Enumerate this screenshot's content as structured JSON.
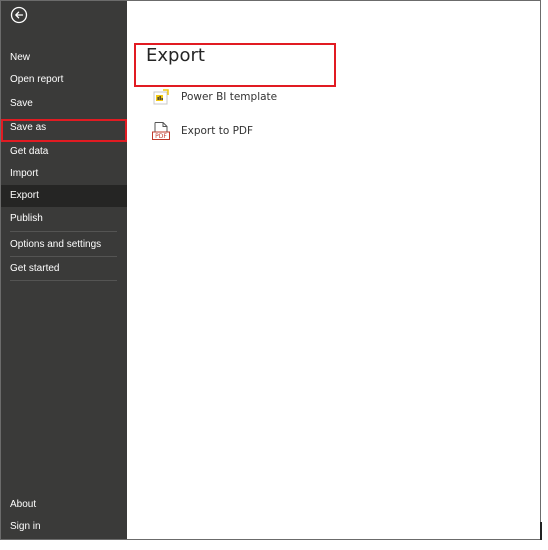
{
  "sidebar": {
    "back_icon": "back-arrow-icon",
    "items": [
      {
        "label": "New"
      },
      {
        "label": "Open report"
      },
      {
        "label": "Save"
      },
      {
        "label": "Save as"
      },
      {
        "label": "Get data"
      },
      {
        "label": "Import"
      },
      {
        "label": "Export"
      },
      {
        "label": "Publish"
      },
      {
        "label": "Options and settings"
      },
      {
        "label": "Get started"
      }
    ],
    "bottom_items": [
      {
        "label": "About"
      },
      {
        "label": "Sign in"
      }
    ],
    "active_item": "Export"
  },
  "main": {
    "title": "Export",
    "options": [
      {
        "label": "Power BI template",
        "icon": "power-bi-template-icon"
      },
      {
        "label": "Export to PDF",
        "icon": "pdf-icon",
        "icon_text": "PDF"
      }
    ]
  },
  "colors": {
    "sidebar_bg": "#3a3a39",
    "sidebar_active_bg": "#252524",
    "highlight_border": "#e11b22",
    "icon_yellow": "#f2c811"
  }
}
